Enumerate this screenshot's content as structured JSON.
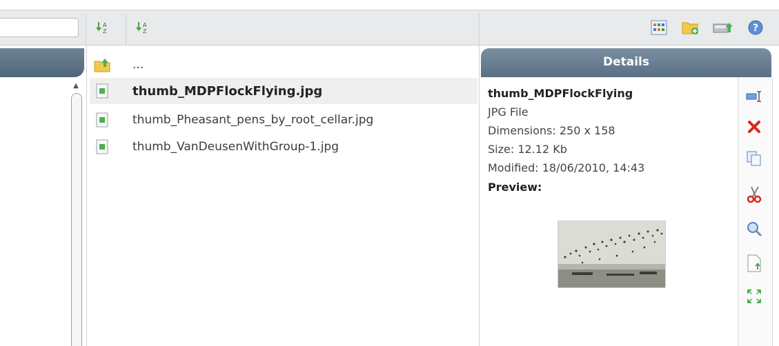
{
  "toolbar": {
    "search": {
      "value": "",
      "placeholder": ""
    },
    "sort_icons": [
      "sort-az-icon",
      "sort-az-icon"
    ],
    "right_icons": [
      "grid-view-icon",
      "new-folder-icon",
      "upload-icon",
      "help-icon"
    ]
  },
  "left_panel": {
    "header": ""
  },
  "file_list": {
    "items": [
      {
        "name": "...",
        "icon": "folder-up-icon",
        "selected": false
      },
      {
        "name": "thumb_MDPFlockFlying.jpg",
        "icon": "image-file-icon",
        "selected": true
      },
      {
        "name": "thumb_Pheasant_pens_by_root_cellar.jpg",
        "icon": "image-file-icon",
        "selected": false
      },
      {
        "name": "thumb_VanDeusenWithGroup-1.jpg",
        "icon": "image-file-icon",
        "selected": false
      }
    ]
  },
  "details": {
    "header": "Details",
    "filename": "thumb_MDPFlockFlying",
    "type": "JPG File",
    "dimensions": "Dimensions: 250 x 158",
    "size": "Size: 12.12 Kb",
    "modified": "Modified: 18/06/2010, 14:43",
    "preview_label": "Preview:"
  },
  "actions": [
    "rename-icon",
    "delete-icon",
    "copy-icon",
    "cut-icon",
    "zoom-icon",
    "move-icon",
    "expand-icon"
  ],
  "colors": {
    "header_blue": "#5a7085",
    "selected_row": "#efefef",
    "toolbar_bg": "#e9eaeb",
    "delete_red": "#d9261c"
  }
}
